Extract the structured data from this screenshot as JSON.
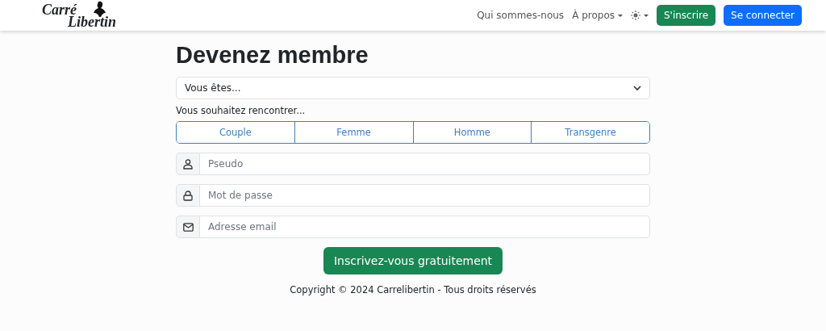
{
  "header": {
    "logo": {
      "line_1": "Carré",
      "line_2": "Libertin"
    },
    "nav": [
      {
        "label": "Qui sommes-nous",
        "kind": "link"
      },
      {
        "label": "À propos",
        "kind": "dropdown"
      },
      {
        "kind": "theme"
      }
    ],
    "buttons": [
      {
        "label": "S'inscrire",
        "kind": "success"
      },
      {
        "label": "Se connecter",
        "kind": "primary"
      }
    ]
  },
  "form": {
    "title": "Devenez membre",
    "select": {
      "value": "Vous êtes..."
    },
    "meet_label": "Vous souhaitez rencontrer...",
    "options": [
      {
        "label": "Couple",
        "selected": false
      },
      {
        "label": "Femme",
        "selected": false
      },
      {
        "label": "Homme",
        "selected": false
      },
      {
        "label": "Transgenre",
        "selected": false
      }
    ],
    "fields": [
      {
        "kind": "user",
        "placeholder": "Pseudo"
      },
      {
        "kind": "lock",
        "placeholder": "Mot de passe"
      },
      {
        "kind": "mail",
        "placeholder": "Adresse email"
      }
    ],
    "submit": "Inscrivez-vous gratuitement"
  },
  "footer": {
    "copyright": "Copyright © 2024 Carrelibertin - Tous droits réservés"
  }
}
